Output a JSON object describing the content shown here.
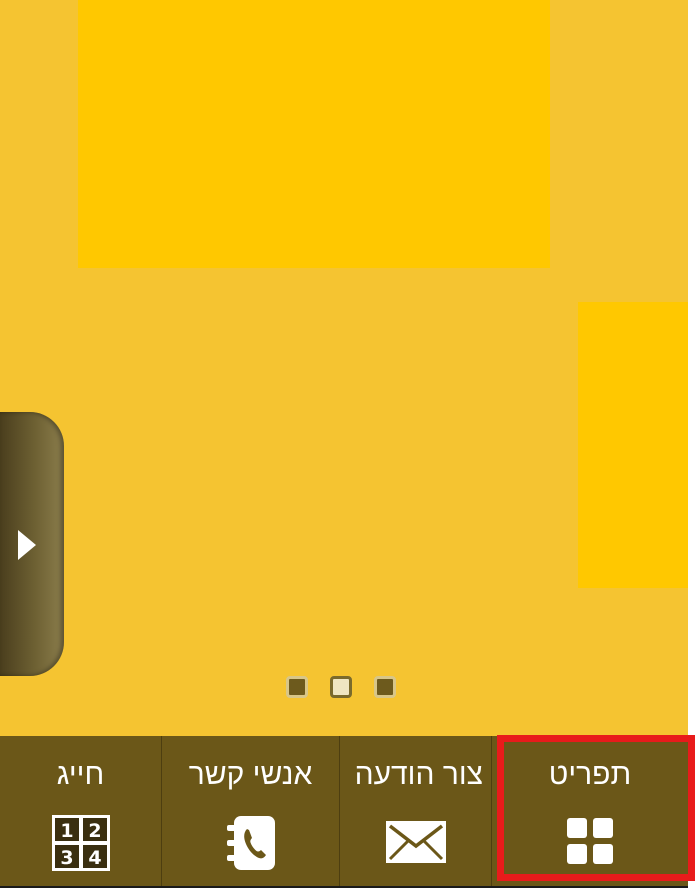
{
  "colors": {
    "background": "#f5c431",
    "tile": "#ffc800",
    "tab_bar": "#6b5718",
    "side_handle": "#6e6133",
    "highlight": "#e81b1b"
  },
  "side_handle": {
    "icon": "chevron-right-icon"
  },
  "pager": {
    "count": 3,
    "active_index": 1
  },
  "tabs": [
    {
      "label": "חייג",
      "icon": "keypad-icon"
    },
    {
      "label": "אנשי קשר",
      "icon": "contacts-phone-icon"
    },
    {
      "label": "צור הודעה",
      "icon": "envelope-icon"
    },
    {
      "label": "תפריט",
      "icon": "menu-grid-icon"
    }
  ],
  "keypad_digits": [
    "1",
    "2",
    "3",
    "4"
  ]
}
